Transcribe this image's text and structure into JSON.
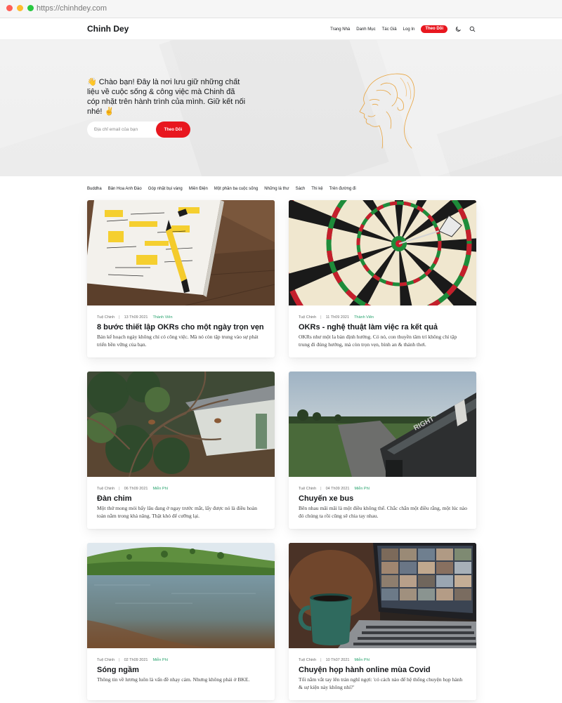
{
  "browser": {
    "url": "https://chinhdey.com",
    "colors": {
      "close": "#fe5f57",
      "minimize": "#febc2e",
      "maximize": "#28c840"
    }
  },
  "header": {
    "brand": "Chinh Dey",
    "nav": [
      "Trang Nhà",
      "Danh Mục",
      "Tác Giả",
      "Log In"
    ],
    "subscribe_label": "Theo Dõi",
    "icons": [
      "moon-icon",
      "search-icon"
    ]
  },
  "hero": {
    "text": "👋 Chào bạn! Đây là nơi lưu giữ những chất liệu về cuộc sống & công việc mà Chinh đã cóp nhặt trên hành trình của mình. Giữ kết nối nhé! ✌️",
    "email_placeholder": "Địa chỉ email của bạn",
    "button_label": "Theo Dõi"
  },
  "tags": [
    "Buddha",
    "Bản Hoa Anh Đào",
    "Góp nhặt bụi vàng",
    "Miền Điện",
    "Một phần ba cuộc sống",
    "Những lá thư",
    "Sách",
    "Thi kệ",
    "Trên đường đi"
  ],
  "posts": [
    {
      "author": "Tuệ Chinh",
      "date": "13 Th09 2021",
      "tier": "Thành Viên",
      "title": "8 bước thiết lập OKRs cho một ngày trọn vẹn",
      "excerpt": "Bản kế hoạch ngày không chỉ có công việc. Mà nó còn tập trung vào sự phát triển bền vững của bạn."
    },
    {
      "author": "Tuệ Chinh",
      "date": "11 Th09 2021",
      "tier": "Thành Viên",
      "title": "OKRs - nghệ thuật làm việc ra kết quả",
      "excerpt": "OKRs như một la bàn định hướng. Có nó, con thuyền tâm trí không chỉ tập trung đi đúng hướng, mà còn trọn vẹn, bình an & thảnh thơi."
    },
    {
      "author": "Tuệ Chinh",
      "date": "06 Th09 2021",
      "tier": "Miễn Phí",
      "title": "Đàn chim",
      "excerpt": "Một thứ mong mỏi bấy lâu đang ở ngay trước mắt, lấy được nó là điều hoàn toàn nằm trong khả năng. Thật khó để cưỡng lại."
    },
    {
      "author": "Tuệ Chinh",
      "date": "04 Th09 2021",
      "tier": "Miễn Phí",
      "title": "Chuyến xe bus",
      "excerpt": "Bên nhau mãi mãi là một điều không thể. Chắc chắn một điều rằng, một lúc nào đó chúng ta rồi cũng sẽ chia tay nhau."
    },
    {
      "author": "Tuệ Chinh",
      "date": "02 Th09 2021",
      "tier": "Miễn Phí",
      "title": "Sóng ngầm",
      "excerpt": "Thông tin về lương luôn là vấn đề nhạy cảm. Nhưng không phải ở BKE."
    },
    {
      "author": "Tuệ Chinh",
      "date": "10 Th07 2021",
      "tier": "Miễn Phí",
      "title": "Chuyện họp hành online mùa Covid",
      "excerpt": "Tối nằm vắt tay lên trán nghĩ ngợi: 'có cách nào để hệ thống chuyện họp hành & sự kiện này không nhỉ?'"
    }
  ],
  "colors": {
    "accent": "#e8171f",
    "tier": "#27a26d",
    "hero_bg": "#eeeeee",
    "art_line": "#e8a33d"
  }
}
